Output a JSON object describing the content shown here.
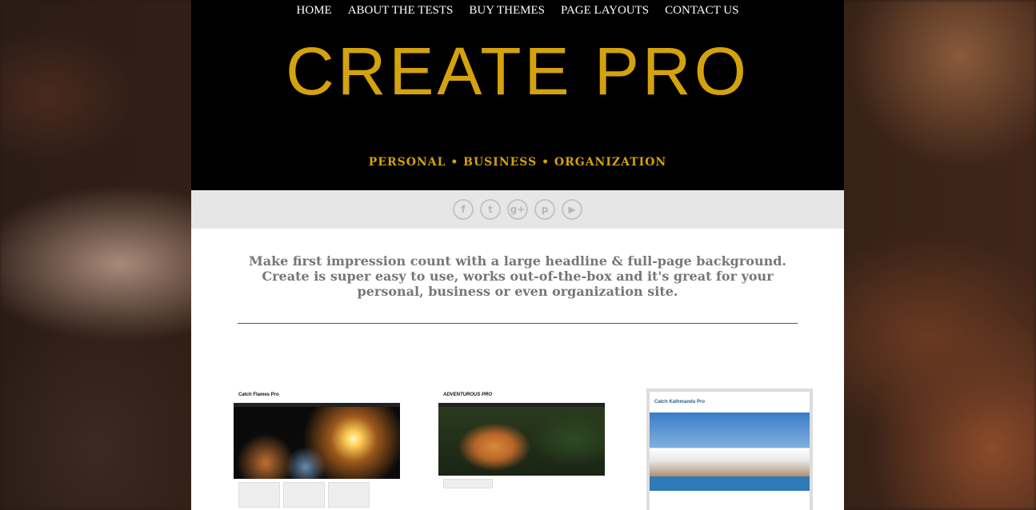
{
  "nav": {
    "items": [
      "HOME",
      "ABOUT THE TESTS",
      "BUY THEMES",
      "PAGE LAYOUTS",
      "CONTACT US"
    ]
  },
  "header": {
    "logo": "CREATE PRO",
    "tagline": "PERSONAL • BUSINESS • ORGANIZATION",
    "accent_color": "#d4a20d"
  },
  "social": {
    "icons": [
      "facebook-icon",
      "twitter-icon",
      "google-plus-icon",
      "pinterest-icon",
      "youtube-icon"
    ],
    "glyphs": [
      "f",
      "t",
      "g+",
      "p",
      "▶"
    ]
  },
  "intro": {
    "text": "Make first impression count with a large headline & full-page background. Create is super easy to use, works out-of-the-box and it's great for your personal, business or even organization site."
  },
  "thumbnails": [
    {
      "title": "Catch Flames Pro"
    },
    {
      "title": "ADVENTUROUS PRO"
    },
    {
      "title": "Catch Kathmandu Pro"
    }
  ]
}
